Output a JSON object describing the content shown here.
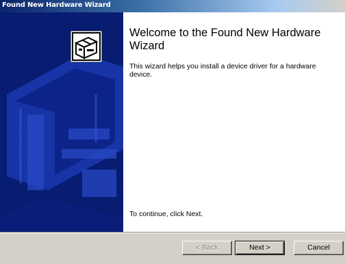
{
  "window": {
    "title": "Found New Hardware Wizard"
  },
  "wizard": {
    "heading": "Welcome to the Found New Hardware Wizard",
    "description": "This wizard helps you install a device driver for a hardware device.",
    "continue_text": "To continue, click Next."
  },
  "buttons": {
    "back_label": "< Back",
    "next_label": "Next >",
    "cancel_label": "Cancel"
  },
  "icons": {
    "hardware": "hardware-device-icon"
  },
  "colors": {
    "banner": "#061a6e",
    "titlebar_start": "#0a246a",
    "face": "#d4d0c8"
  }
}
